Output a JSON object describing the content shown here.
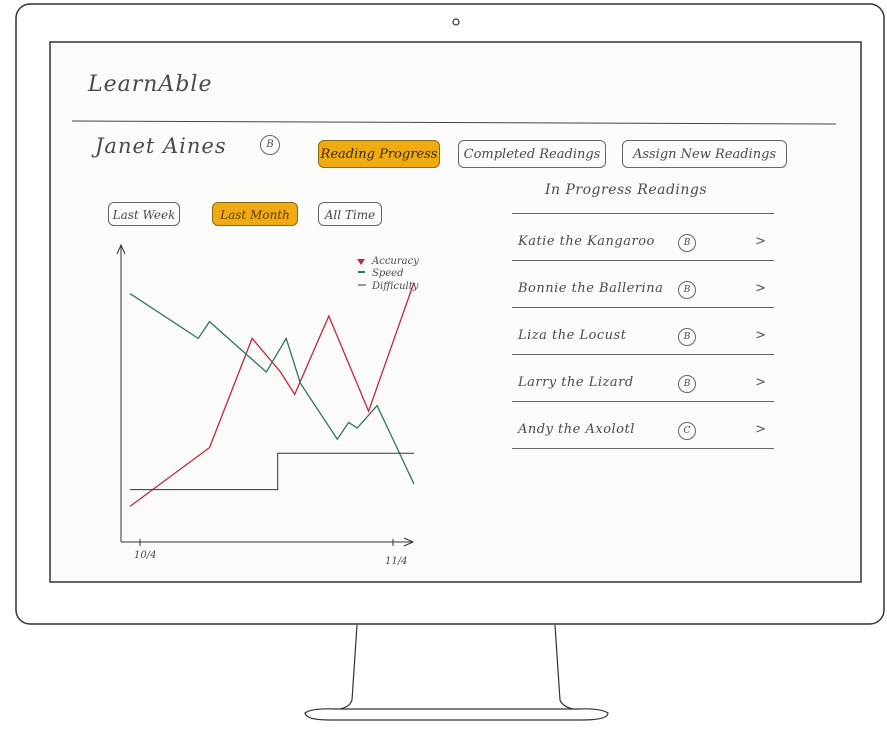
{
  "app": {
    "title": "LearnAble"
  },
  "student": {
    "name": "Janet Aines",
    "level": "B"
  },
  "tabs": [
    {
      "label": "Reading Progress",
      "active": true
    },
    {
      "label": "Completed Readings",
      "active": false
    },
    {
      "label": "Assign New Readings",
      "active": false
    }
  ],
  "filters": [
    {
      "label": "Last Week",
      "active": false
    },
    {
      "label": "Last Month",
      "active": true
    },
    {
      "label": "All Time",
      "active": false
    }
  ],
  "in_progress": {
    "heading": "In Progress Readings",
    "items": [
      {
        "title": "Katie the Kangaroo",
        "level": "B",
        "chevron": ">"
      },
      {
        "title": "Bonnie the Ballerina",
        "level": "B",
        "chevron": ">"
      },
      {
        "title": "Liza the Locust",
        "level": "B",
        "chevron": ">"
      },
      {
        "title": "Larry the Lizard",
        "level": "B",
        "chevron": ">"
      },
      {
        "title": "Andy the Axolotl",
        "level": "C",
        "chevron": ">"
      }
    ]
  },
  "colors": {
    "accent": "#f0ab13",
    "accuracy": "#c0283a",
    "speed": "#2e7466",
    "difficulty": "#333333"
  },
  "chart_data": {
    "type": "line",
    "x_ticks": [
      "10/4",
      "11/4"
    ],
    "legend": [
      "Accuracy",
      "Speed",
      "Difficulty"
    ],
    "series": [
      {
        "name": "Accuracy",
        "x": [
          0,
          0.28,
          0.43,
          0.53,
          0.58,
          0.7,
          0.84,
          1.0
        ],
        "y": [
          0.12,
          0.33,
          0.72,
          0.6,
          0.52,
          0.8,
          0.46,
          0.92
        ]
      },
      {
        "name": "Speed",
        "x": [
          0,
          0.24,
          0.28,
          0.48,
          0.55,
          0.6,
          0.73,
          0.77,
          0.8,
          0.87,
          1.0
        ],
        "y": [
          0.88,
          0.72,
          0.78,
          0.6,
          0.72,
          0.56,
          0.36,
          0.42,
          0.4,
          0.48,
          0.2
        ]
      },
      {
        "name": "Difficulty",
        "x": [
          0,
          0.52,
          0.52,
          1.0
        ],
        "y": [
          0.18,
          0.18,
          0.31,
          0.31
        ]
      }
    ]
  }
}
